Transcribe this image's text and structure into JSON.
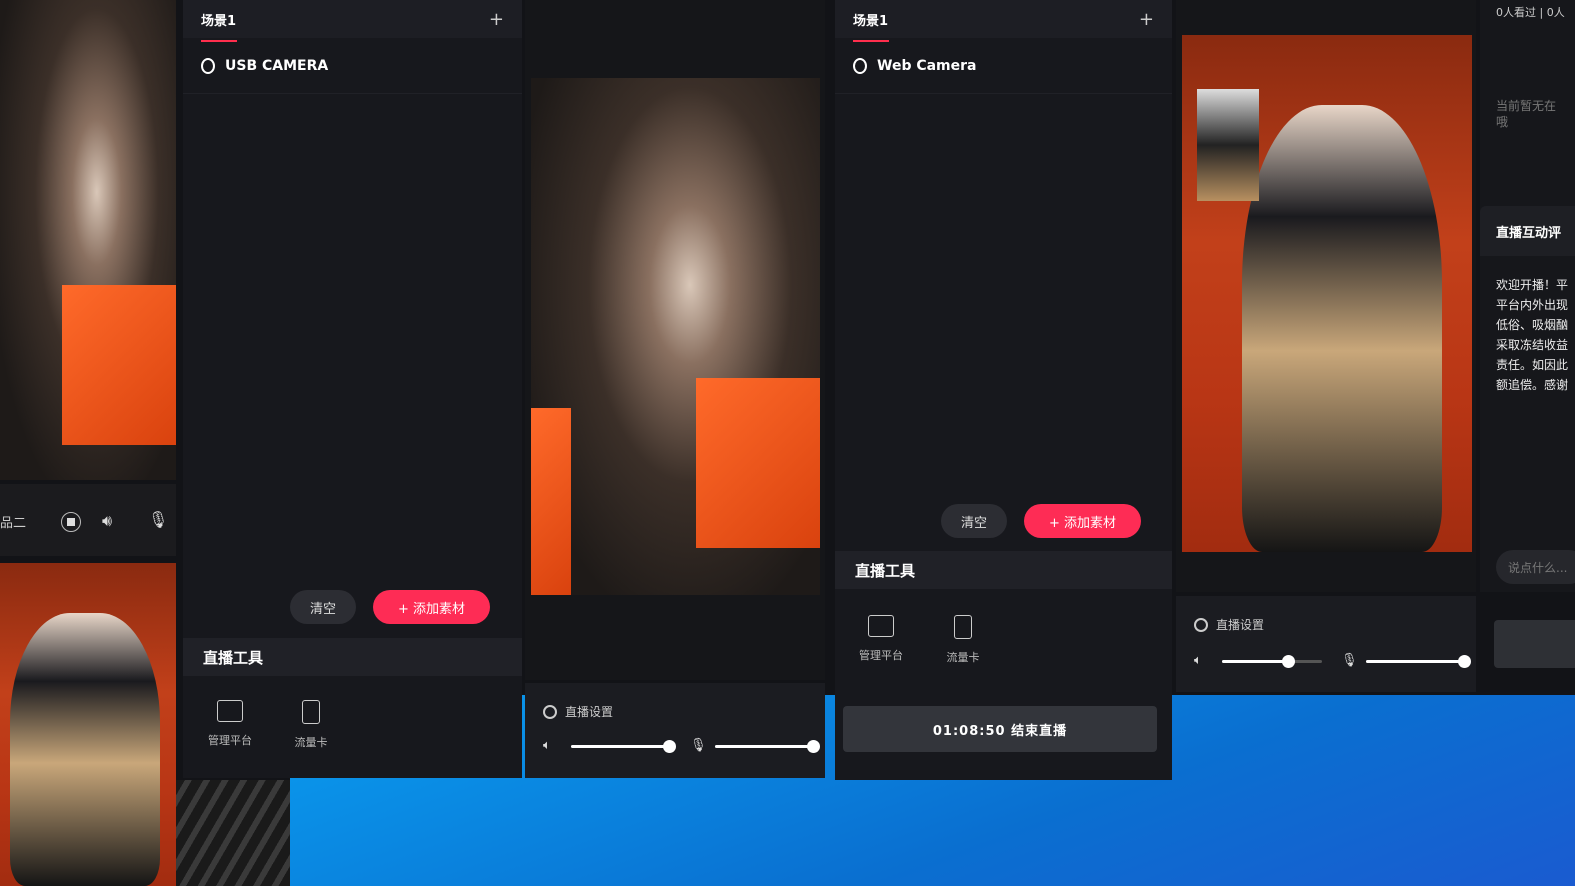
{
  "left_strip": {
    "label_partial": "品二",
    "icons": [
      "stop-icon",
      "speaker-icon",
      "microphone-icon"
    ]
  },
  "panel_usb": {
    "scene_tab": "场景1",
    "camera_name": "USB CAMERA",
    "clear_label": "清空",
    "add_label": "+ 添加素材",
    "tools_title": "直播工具",
    "tools": [
      {
        "label": "管理平台",
        "icon": "monitor-chart-icon"
      },
      {
        "label": "流量卡",
        "icon": "lightning-card-icon"
      }
    ]
  },
  "panel_preview": {
    "settings_label": "直播设置",
    "volume": 1.0,
    "mic_volume": 1.0
  },
  "panel_web": {
    "scene_tab": "场景1",
    "camera_name": "Web Camera",
    "clear_label": "清空",
    "add_label": "+ 添加素材",
    "tools_title": "直播工具",
    "tools": [
      {
        "label": "管理平台",
        "icon": "monitor-chart-icon"
      },
      {
        "label": "流量卡",
        "icon": "lightning-card-icon"
      }
    ],
    "end_live_label": "01:08:50 结束直播"
  },
  "panel_right_preview": {
    "settings_label": "直播设置",
    "volume": 0.67,
    "mic_volume": 1.0
  },
  "side": {
    "viewers": "0人看过",
    "viewers2": "0人",
    "empty_partial": "当前暂无在",
    "empty_partial2": "哦",
    "comments_title": "直播互动评",
    "chat_lines": [
      "欢迎开播！平",
      "平台内外出现",
      "低俗、吸烟酗",
      "采取冻结收益",
      "责任。如因此",
      "额追偿。感谢"
    ],
    "input_placeholder": "说点什么..."
  },
  "colors": {
    "accent": "#fe2c55",
    "panel": "#17181d",
    "desktop": "#0a8fe0"
  }
}
